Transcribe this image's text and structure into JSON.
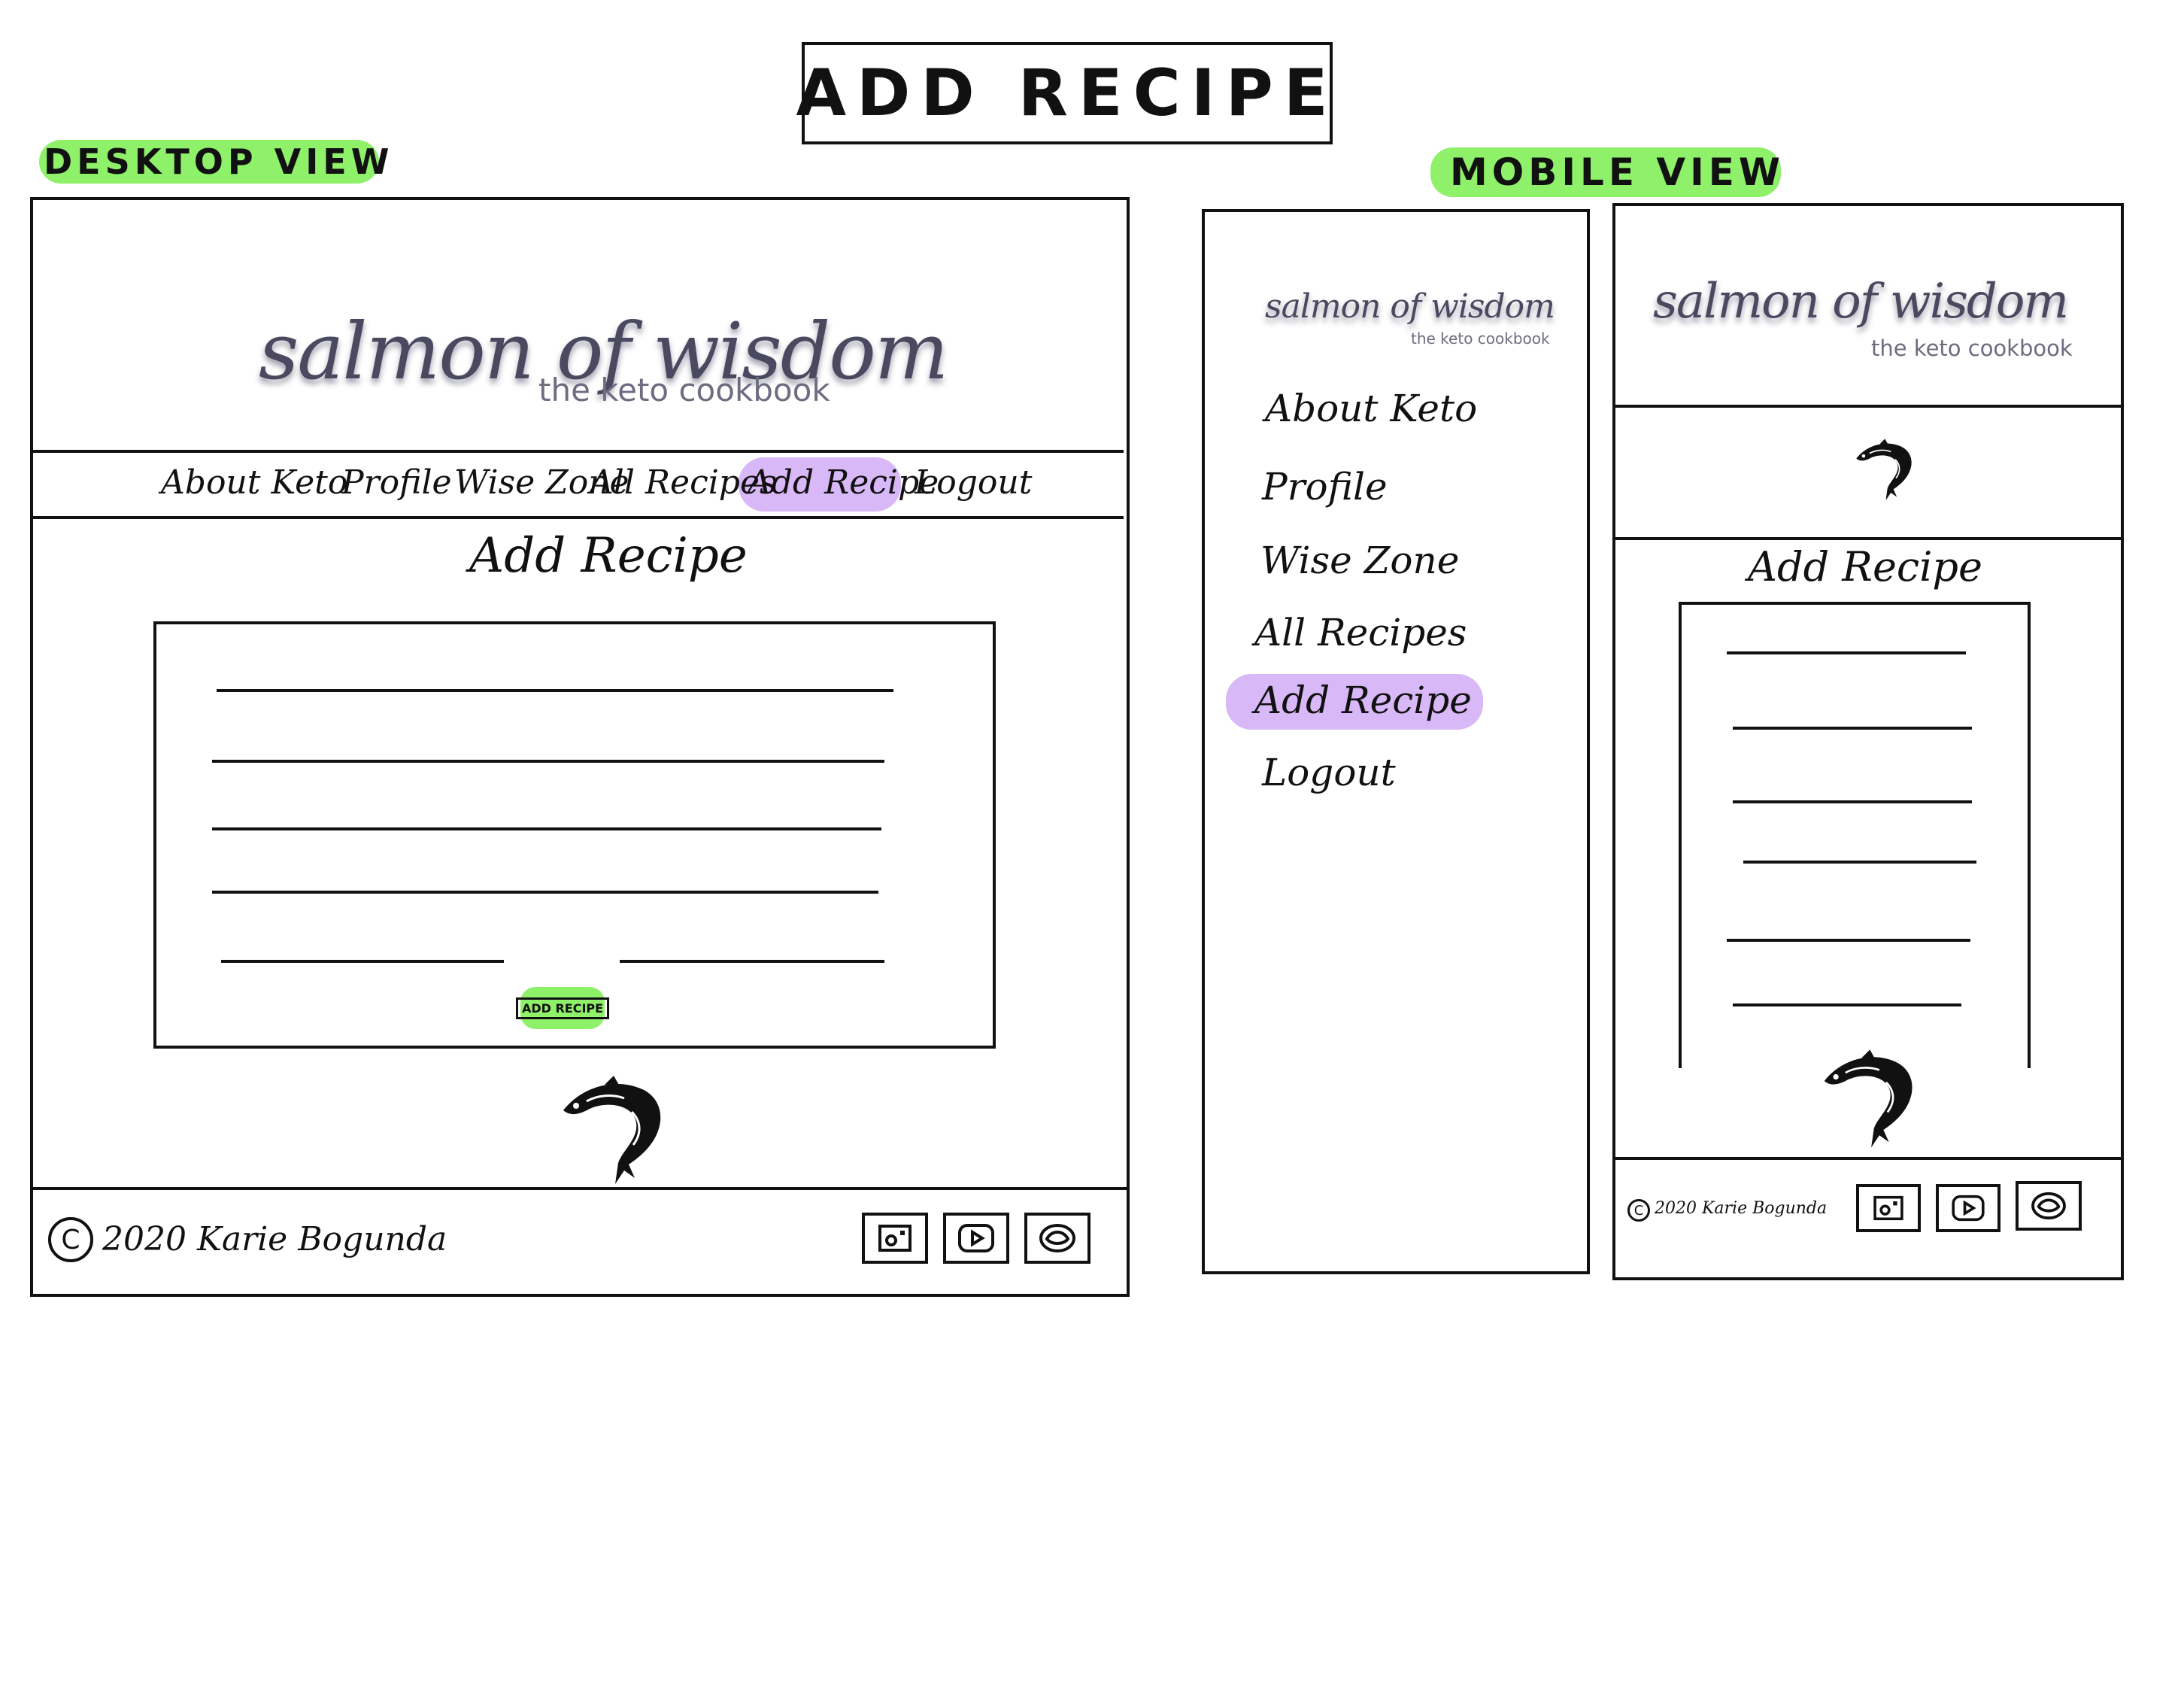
{
  "page_title": "ADD RECIPE",
  "desktop": {
    "view_label": "DESKTOP VIEW",
    "logo": {
      "title": "salmon of wisdom",
      "subtitle": "the keto cookbook"
    },
    "nav": [
      {
        "label": "About Keto"
      },
      {
        "label": "Profile"
      },
      {
        "label": "Wise Zone"
      },
      {
        "label": "All Recipes"
      },
      {
        "label": "Add Recipe",
        "active": true
      },
      {
        "label": "Logout"
      }
    ],
    "heading": "Add Recipe",
    "submit_button": "ADD RECIPE",
    "footer": {
      "copyright": "2020 Karie Bogunda",
      "social_icons": [
        "instagram-icon",
        "youtube-icon",
        "other-social-icon"
      ]
    }
  },
  "mobile": {
    "view_label": "MOBILE VIEW",
    "menu": {
      "logo": {
        "title": "salmon of wisdom",
        "subtitle": "the keto cookbook"
      },
      "items": [
        {
          "label": "About Keto"
        },
        {
          "label": "Profile"
        },
        {
          "label": "Wise Zone"
        },
        {
          "label": "All Recipes"
        },
        {
          "label": "Add Recipe",
          "active": true
        },
        {
          "label": "Logout"
        }
      ]
    },
    "page": {
      "logo": {
        "title": "salmon of wisdom",
        "subtitle": "the keto cookbook"
      },
      "heading": "Add Recipe",
      "footer": {
        "copyright": "2020 Karie Bogunda",
        "social_icons": [
          "instagram-icon",
          "youtube-icon",
          "other-social-icon"
        ]
      }
    }
  },
  "colors": {
    "highlight_green": "#8ff06a",
    "highlight_purple": "#d9b8f7",
    "logo_ink": "#4a4960"
  }
}
